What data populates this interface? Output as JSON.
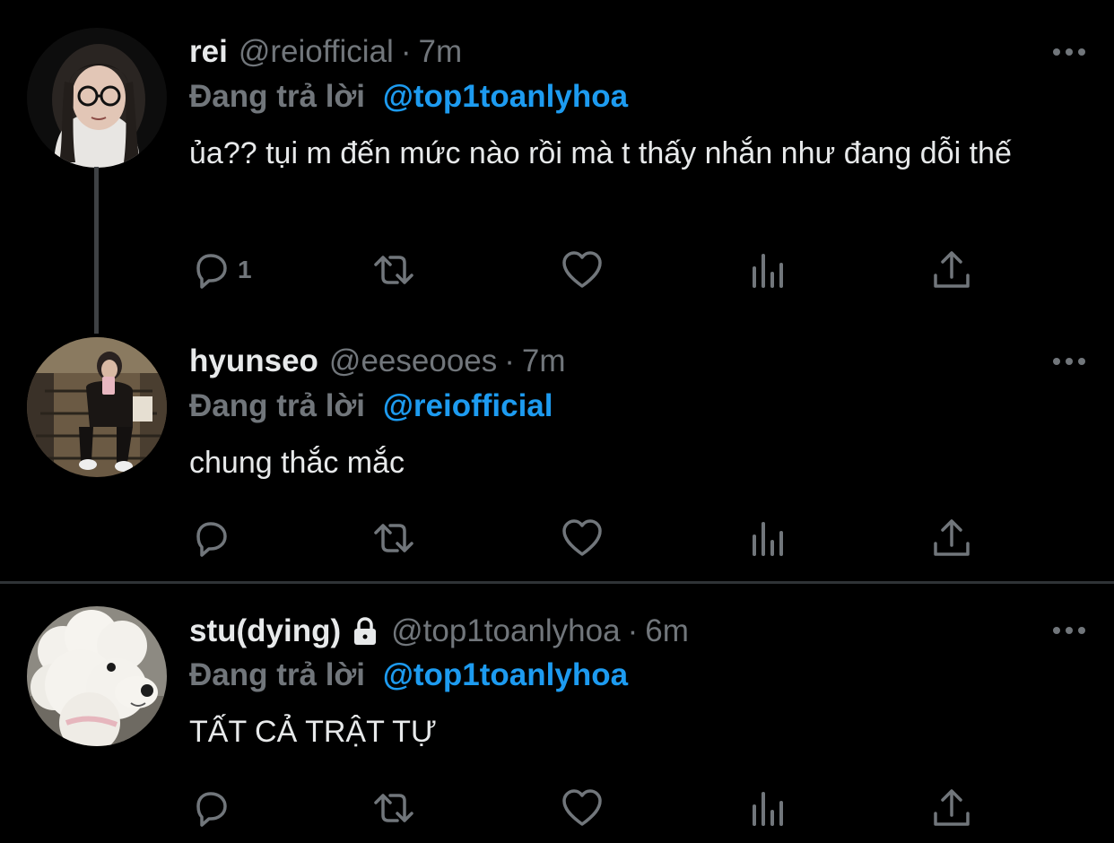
{
  "tweets": [
    {
      "name": "rei",
      "handle": "@reiofficial",
      "dot": "·",
      "time": "7m",
      "reply_prefix": "Đang trả lời",
      "reply_to": "@top1toanlyhoa",
      "text": "ủa?? tụi m đến mức nào rồi mà t thấy nhắn như đang dỗi thế",
      "reply_count": "1",
      "avatar_icon": "girl-with-glasses-avatar"
    },
    {
      "name": "hyunseo",
      "handle": "@eeseooes",
      "dot": "·",
      "time": "7m",
      "reply_prefix": "Đang trả lời",
      "reply_to": "@reiofficial",
      "text": "chung thắc mắc",
      "reply_count": "",
      "avatar_icon": "mirror-selfie-avatar"
    },
    {
      "name": "stu(dying)",
      "handle": "@top1toanlyhoa",
      "dot": "·",
      "time": "6m",
      "reply_prefix": "Đang trả lời",
      "reply_to": "@top1toanlyhoa",
      "text": "TẤT CẢ TRẬT TỰ",
      "reply_count": "",
      "avatar_icon": "white-poodle-avatar",
      "protected_icon": "lock-icon"
    }
  ],
  "colors": {
    "background": "#000000",
    "text": "#e7e9ea",
    "muted": "#71767b",
    "link": "#1d9bf0",
    "divider": "#2f3336"
  }
}
